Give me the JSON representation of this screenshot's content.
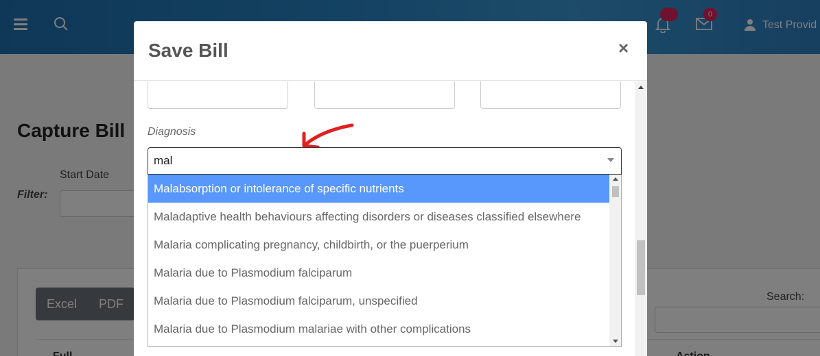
{
  "header": {
    "user_name": "Test Provid",
    "notification_count": "",
    "mail_count": "0",
    "icons": [
      "menu-icon",
      "search-icon",
      "bell-icon",
      "mail-icon",
      "user-icon"
    ]
  },
  "page": {
    "title": "Capture Bill",
    "filter_label": "Filter:",
    "start_date_label": "Start Date",
    "export_buttons": [
      "Excel",
      "PDF"
    ],
    "search_label": "Search:",
    "table_columns": [
      "Full",
      "Action"
    ]
  },
  "modal": {
    "title": "Save Bill",
    "close_symbol": "×",
    "diagnosis_label": "Diagnosis",
    "diagnosis_value": "mal",
    "options": [
      "Malabsorption or intolerance of specific nutrients",
      "Maladaptive health behaviours affecting disorders or diseases classified elsewhere",
      "Malaria complicating pregnancy, childbirth, or the puerperium",
      "Malaria due to Plasmodium falciparum",
      "Malaria due to Plasmodium falciparum, unspecified",
      "Malaria due to Plasmodium malariae with other complications"
    ],
    "highlighted_option_index": 0
  },
  "colors": {
    "topbar": "#2a86c6",
    "highlight": "#5897fb",
    "badge": "#e0245e",
    "annotation_arrow": "#e02020"
  }
}
